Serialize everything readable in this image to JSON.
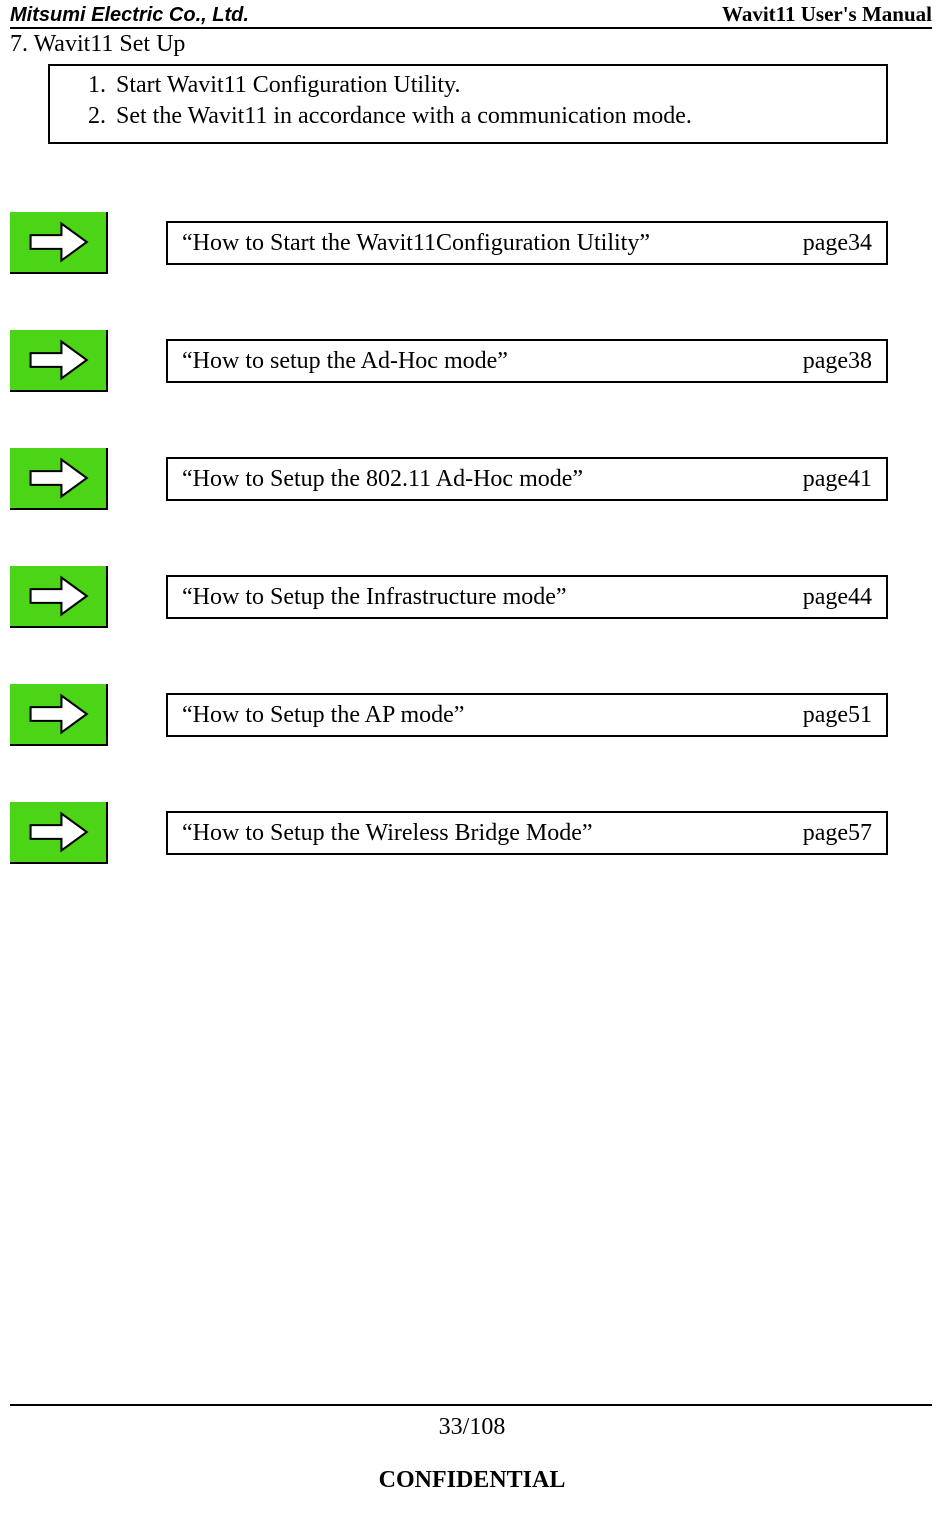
{
  "header": {
    "company": "Mitsumi Electric Co., Ltd.",
    "manual_title": "Wavit11 User's Manual"
  },
  "section_title": "7. Wavit11 Set Up",
  "intro_steps": [
    "Start Wavit11 Configuration Utility.",
    "Set the Wavit11 in accordance with a communication mode."
  ],
  "links": [
    {
      "title": "“How to Start the Wavit11Configuration Utility”",
      "page": "page34"
    },
    {
      "title": "“How to setup the Ad-Hoc mode”",
      "page": "page38"
    },
    {
      "title": "“How to Setup the 802.11 Ad-Hoc mode”",
      "page": "page41"
    },
    {
      "title": "“How to Setup the Infrastructure mode”",
      "page": "page44"
    },
    {
      "title": "“How to Setup the AP mode”",
      "page": "page51"
    },
    {
      "title": "“How to Setup the Wireless Bridge Mode”",
      "page": "page57"
    }
  ],
  "footer": {
    "page_indicator": "33/108",
    "confidential": "CONFIDENTIAL"
  }
}
